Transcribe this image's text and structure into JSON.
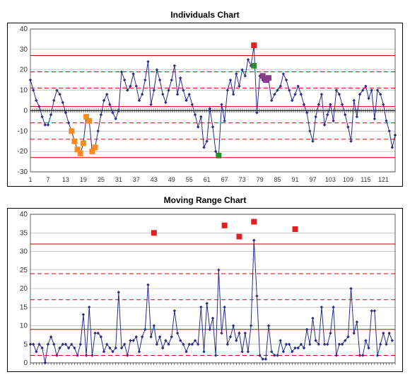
{
  "chart_data": [
    {
      "type": "line",
      "title": "Individuals Chart",
      "ylim": [
        -30,
        40
      ],
      "yticks": [
        -30,
        -20,
        -10,
        0,
        10,
        20,
        30,
        40
      ],
      "xticks": [
        1,
        7,
        13,
        19,
        25,
        31,
        37,
        43,
        49,
        55,
        61,
        67,
        73,
        79,
        85,
        91,
        97,
        103,
        109,
        115,
        121
      ],
      "x_start": 1,
      "x_end": 125,
      "control_lines": [
        {
          "y": 27,
          "style": "solid"
        },
        {
          "y": 19,
          "style": "dash"
        },
        {
          "y": 11,
          "style": "dash"
        },
        {
          "y": 2,
          "style": "solid"
        },
        {
          "y": -6,
          "style": "dash"
        },
        {
          "y": -14,
          "style": "dash"
        },
        {
          "y": -23,
          "style": "solid"
        }
      ],
      "series": [
        {
          "name": "Individuals",
          "color": "#2a2a8a",
          "values": [
            15,
            10,
            5,
            2,
            -3,
            -7,
            -7,
            -2,
            5,
            10,
            8,
            4,
            -1,
            -6,
            -10,
            -15,
            -19,
            -21,
            -16,
            -3,
            -5,
            -20,
            -18,
            -10,
            -2,
            5,
            8,
            3,
            -1,
            -4,
            0,
            19,
            15,
            10,
            12,
            18,
            12,
            5,
            8,
            15,
            24,
            3,
            10,
            20,
            15,
            8,
            4,
            10,
            15,
            22,
            8,
            16,
            10,
            5,
            8,
            3,
            -2,
            -8,
            -3,
            -18,
            -15,
            1,
            -8,
            -20,
            -22,
            3,
            -5,
            10,
            15,
            8,
            18,
            12,
            20,
            17,
            25,
            22,
            32,
            -1,
            17,
            15,
            16,
            15,
            5,
            8,
            10,
            12,
            18,
            15,
            10,
            5,
            8,
            12,
            8,
            3,
            -1,
            -10,
            -15,
            -3,
            3,
            8,
            -7,
            -2,
            3,
            -5,
            10,
            8,
            3,
            -2,
            -8,
            -15,
            5,
            -3,
            8,
            10,
            12,
            6,
            10,
            -4,
            10,
            8,
            3,
            -5,
            -10,
            -18,
            -12
          ]
        }
      ],
      "special_points": {
        "orange": [
          {
            "x": 15,
            "y": -10
          },
          {
            "x": 16,
            "y": -15
          },
          {
            "x": 17,
            "y": -19
          },
          {
            "x": 18,
            "y": -21
          },
          {
            "x": 19,
            "y": -16
          },
          {
            "x": 20,
            "y": -3
          },
          {
            "x": 21,
            "y": -5
          },
          {
            "x": 22,
            "y": -20
          },
          {
            "x": 23,
            "y": -18
          }
        ],
        "green": [
          {
            "x": 65,
            "y": -22
          },
          {
            "x": 77,
            "y": 22
          }
        ],
        "red": [
          {
            "x": 77,
            "y": 32
          }
        ],
        "purple": [
          {
            "x": 80,
            "y": 17
          },
          {
            "x": 81,
            "y": 15
          },
          {
            "x": 82,
            "y": 16
          }
        ]
      }
    },
    {
      "type": "line",
      "title": "Moving Range Chart",
      "ylim": [
        0,
        40
      ],
      "yticks": [
        0,
        5,
        10,
        15,
        20,
        25,
        30,
        35,
        40
      ],
      "x_start": 1,
      "x_end": 125,
      "control_lines": [
        {
          "y": 32,
          "style": "solid"
        },
        {
          "y": 24,
          "style": "dash"
        },
        {
          "y": 17,
          "style": "dash"
        },
        {
          "y": 9,
          "style": "solid"
        },
        {
          "y": 2,
          "style": "dash"
        }
      ],
      "series": [
        {
          "name": "Moving Range",
          "color": "#2a2a8a",
          "values": [
            5,
            5,
            3,
            5,
            4,
            0,
            5,
            7,
            5,
            2,
            4,
            5,
            5,
            4,
            5,
            4,
            2,
            5,
            13,
            2,
            15,
            2,
            8,
            8,
            7,
            3,
            5,
            4,
            3,
            4,
            19,
            4,
            5,
            2,
            6,
            6,
            7,
            3,
            7,
            9,
            21,
            7,
            10,
            5,
            7,
            4,
            6,
            5,
            7,
            14,
            8,
            6,
            5,
            3,
            5,
            5,
            6,
            5,
            15,
            3,
            16,
            9,
            12,
            2,
            25,
            8,
            15,
            5,
            7,
            10,
            6,
            8,
            3,
            8,
            3,
            10,
            33,
            18,
            2,
            1,
            1,
            10,
            3,
            2,
            2,
            6,
            3,
            5,
            5,
            3,
            4,
            4,
            5,
            4,
            9,
            5,
            12,
            6,
            5,
            15,
            5,
            5,
            8,
            15,
            2,
            5,
            5,
            6,
            7,
            20,
            8,
            11,
            2,
            2,
            6,
            4,
            14,
            14,
            2,
            5,
            8,
            5,
            8,
            6
          ]
        }
      ],
      "special_points": {
        "red": [
          {
            "x": 43,
            "y": 35
          },
          {
            "x": 67,
            "y": 37
          },
          {
            "x": 72,
            "y": 34
          },
          {
            "x": 77,
            "y": 38
          },
          {
            "x": 91,
            "y": 36
          }
        ]
      }
    }
  ]
}
